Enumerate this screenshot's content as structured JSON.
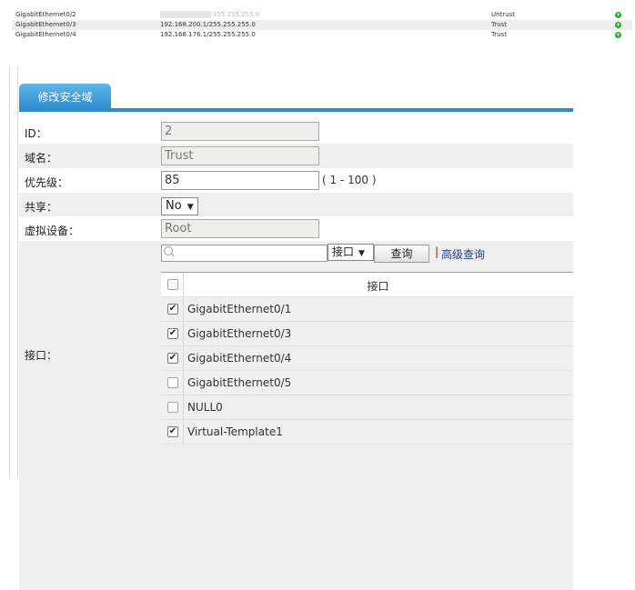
{
  "top_table": {
    "rows": [
      {
        "interface": "GigabitEthernet0/2",
        "ip": "255.255.255.0",
        "zone": "Untrust"
      },
      {
        "interface": "GigabitEthernet0/3",
        "ip": "192.168.200.1/255.255.255.0",
        "zone": "Trust"
      },
      {
        "interface": "GigabitEthernet0/4",
        "ip": "192.168.176.1/255.255.255.0",
        "zone": "Trust"
      }
    ],
    "action_icon": "plus-circle-icon"
  },
  "tab": {
    "label": "修改安全域"
  },
  "form": {
    "id_label": "ID：",
    "id_value": "2",
    "name_label": "域名：",
    "name_value": "Trust",
    "priority_label": "优先级：",
    "priority_value": "85",
    "priority_hint": "( 1 - 100 )",
    "share_label": "共享：",
    "share_value": "No",
    "vdev_label": "虚拟设备：",
    "vdev_value": "Root",
    "interface_label": "接口："
  },
  "interfaces": {
    "search_placeholder": "",
    "filter_value": "接口",
    "query_button": "查询",
    "separator": "|",
    "advanced_link": "高级查询",
    "column_header": "接口",
    "rows": [
      {
        "name": "GigabitEthernet0/1",
        "checked": true
      },
      {
        "name": "GigabitEthernet0/3",
        "checked": true
      },
      {
        "name": "GigabitEthernet0/4",
        "checked": true
      },
      {
        "name": "GigabitEthernet0/5",
        "checked": false
      },
      {
        "name": "NULL0",
        "checked": false
      },
      {
        "name": "Virtual-Template1",
        "checked": true
      }
    ]
  },
  "colors": {
    "tab_blue": "#2e8ccd",
    "link_blue": "#1a3d9c",
    "ok_green": "#2fa62f"
  }
}
